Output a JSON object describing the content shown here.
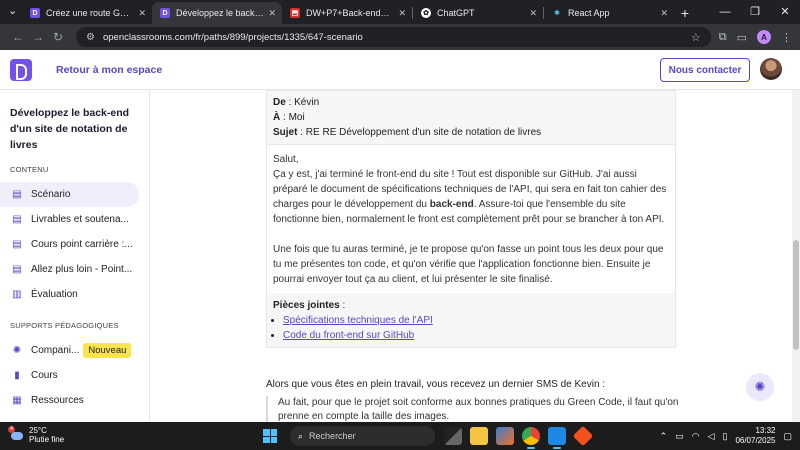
{
  "browser": {
    "tabs": [
      {
        "title": "Créez une route GET - Open",
        "active": false,
        "color": "#7451eb",
        "icon": "openclassrooms-icon"
      },
      {
        "title": "Développez le back-end d'u",
        "active": true,
        "color": "#7451eb",
        "icon": "openclassrooms-icon"
      },
      {
        "title": "DW+P7+Back-end+-+Spec",
        "active": false,
        "color": "#d93025",
        "icon": "pdf-icon"
      },
      {
        "title": "ChatGPT",
        "active": false,
        "color": "#ffffff",
        "icon": "chatgpt-icon"
      },
      {
        "title": "React App",
        "active": false,
        "color": "#61dafb",
        "icon": "react-icon"
      }
    ],
    "url": "openclassrooms.com/fr/paths/899/projects/1335/647-scenario",
    "profile_initial": "A"
  },
  "header": {
    "back_label": "Retour à mon espace",
    "contact_label": "Nous contacter"
  },
  "sidebar": {
    "title": "Développez le back-end d'un site de notation de livres",
    "section_content": "CONTENU",
    "items": [
      {
        "label": "Scénario",
        "active": true
      },
      {
        "label": "Livrables et soutena..."
      },
      {
        "label": "Cours point carrière :..."
      },
      {
        "label": "Allez plus loin - Point..."
      },
      {
        "label": "Évaluation"
      }
    ],
    "section_supports": "SUPPORTS PÉDAGOGIQUES",
    "supports": [
      {
        "label": "Compani...",
        "badge": "Nouveau"
      },
      {
        "label": "Cours"
      },
      {
        "label": "Ressources"
      }
    ]
  },
  "email": {
    "from_label": "De",
    "from": "Kévin",
    "to_label": "À",
    "to": "Moi",
    "subject_label": "Sujet",
    "subject": "RE RE Développement d'un site de notation de livres",
    "greeting": "Salut,",
    "p1_a": "Ça y est, j'ai terminé le front-end du site ! Tout est disponible sur GitHub. J'ai aussi préparé le document de spécifications techniques de l'API, qui sera en fait ton cahier des charges pour le développement du ",
    "p1_bold": "back-end",
    "p1_b": ". Assure-toi que l'ensemble du site fonctionne bien, normalement le front est complètement prêt pour se brancher à ton API.",
    "p2": "Une fois que tu auras terminé, je te propose qu'on fasse un point tous les deux pour que tu me présentes ton code, et qu'on vérifie que l'application fonctionne bien. Ensuite je pourrai envoyer tout ça au client, et lui présenter le site finalisé.",
    "attachments_label": "Pièces jointes",
    "attachments": [
      "Spécifications techniques de l'API",
      "Code du front-end sur GitHub"
    ]
  },
  "content": {
    "after_text": "Alors que vous êtes en plein travail, vous recevez un dernier SMS de Kevin :",
    "quote": "Au fait, pour que le projet soit conforme aux bonnes pratiques du Green Code, il faut qu'on prenne en compte la taille des images."
  },
  "taskbar": {
    "weather_temp": "25°C",
    "weather_desc": "Plutie fine",
    "weather_badge": "4",
    "search_placeholder": "Rechercher",
    "time": "13:32",
    "date": "06/07/2025"
  }
}
